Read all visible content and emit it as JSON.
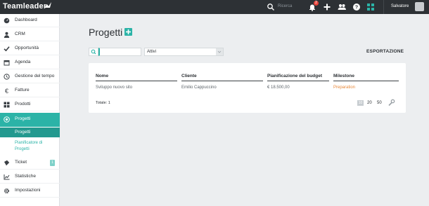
{
  "topbar": {
    "logo": "Teamleader",
    "search_label": "Ricerca",
    "notification_count": "2",
    "username": "Salvatore"
  },
  "sidebar": {
    "items": [
      {
        "label": "Dashboard",
        "icon": "dashboard-icon"
      },
      {
        "label": "CRM",
        "icon": "person-icon"
      },
      {
        "label": "Opportunità",
        "icon": "check-icon"
      },
      {
        "label": "Agenda",
        "icon": "calendar-icon"
      },
      {
        "label": "Gestione del tempo",
        "icon": "clock-icon"
      },
      {
        "label": "Fatture",
        "icon": "euro-icon"
      },
      {
        "label": "Prodotti",
        "icon": "grid-icon"
      },
      {
        "label": "Progetti",
        "icon": "target-icon"
      },
      {
        "label": "Ticket",
        "icon": "ticket-icon",
        "badge": "1"
      },
      {
        "label": "Statistiche",
        "icon": "chart-icon"
      },
      {
        "label": "Impostazioni",
        "icon": "gear-icon"
      }
    ],
    "sub_items": [
      {
        "label": "Progetti"
      },
      {
        "label_line1": "Pianificatore di",
        "label_line2": "Progetti"
      }
    ]
  },
  "main": {
    "title": "Progetti",
    "filter_value": "Attivi",
    "export_label": "ESPORTAZIONE",
    "table": {
      "headers": [
        "Nome",
        "Cliente",
        "Pianificazione del budget",
        "Milestone"
      ],
      "rows": [
        [
          "Sviluppo nuovo sito",
          "Emilio Cappuccino",
          "€ 18.500,00",
          "Preparation"
        ]
      ]
    },
    "total": "Totale: 1",
    "pager": [
      "10",
      "20",
      "50"
    ]
  },
  "colors": {
    "accent": "#2bb3a7",
    "topbar": "#2d3135",
    "milestone": "#e8893a"
  }
}
